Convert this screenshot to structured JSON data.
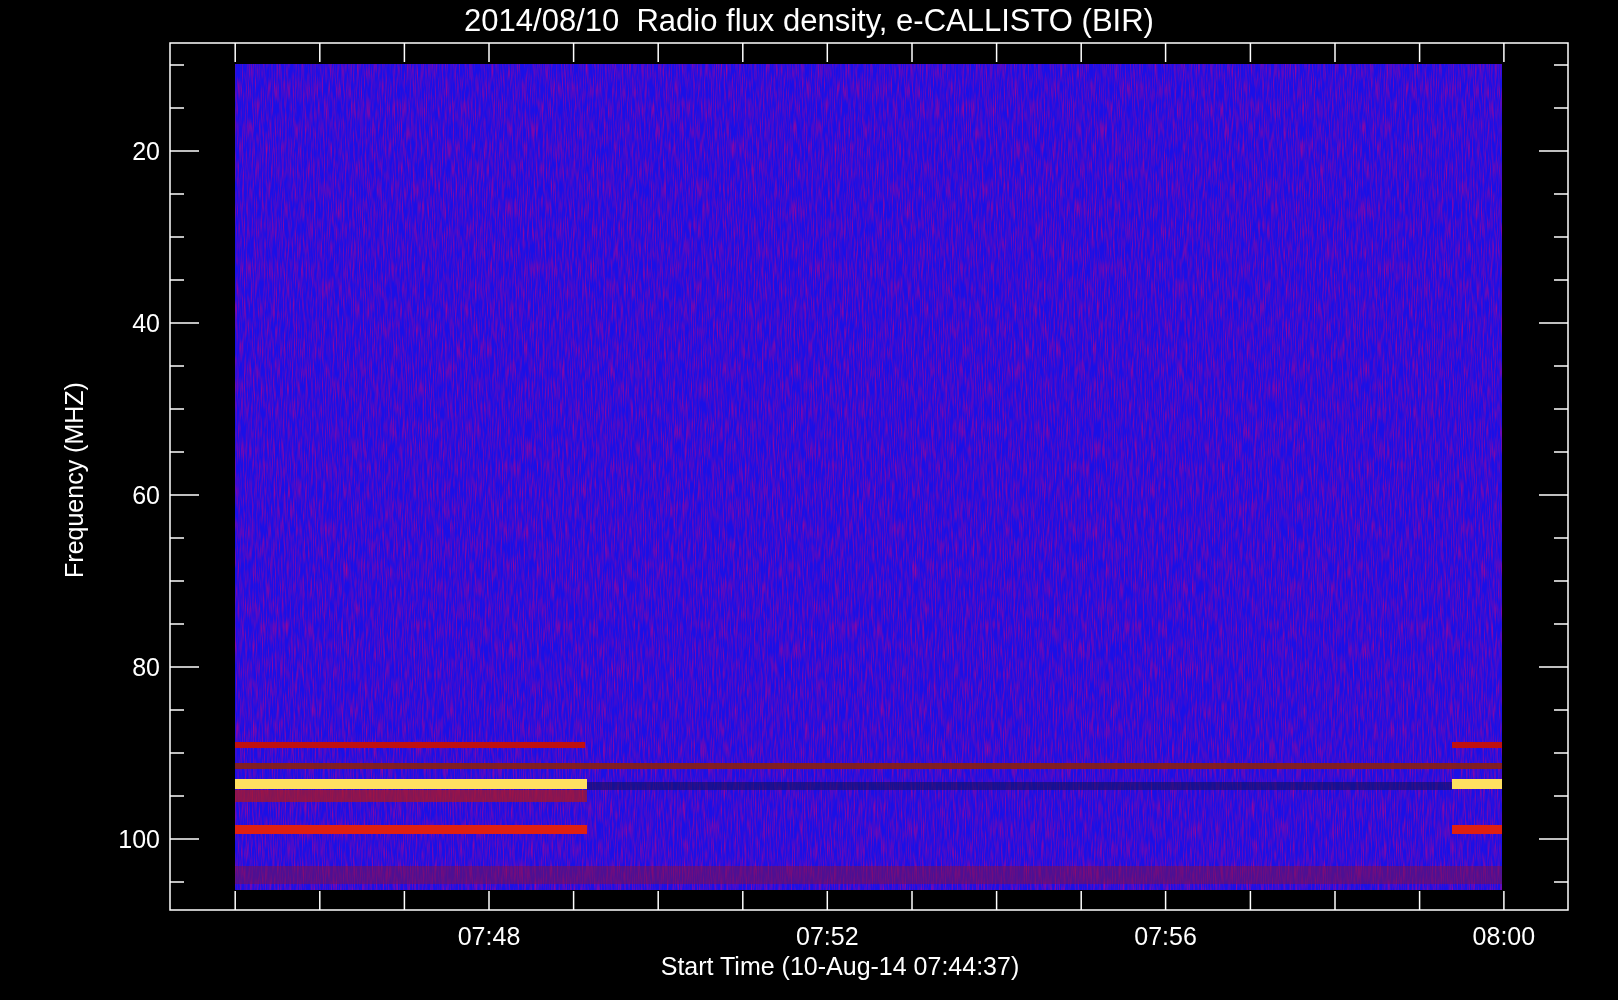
{
  "title": "2014/08/10  Radio flux density, e-CALLISTO (BIR)",
  "xlabel": "Start Time (10-Aug-14 07:44:37)",
  "ylabel": "Frequency (MHZ)",
  "x_ticks": [
    {
      "label": "07:48"
    },
    {
      "label": "07:52"
    },
    {
      "label": "07:56"
    },
    {
      "label": "08:00"
    }
  ],
  "y_ticks": [
    {
      "label": "20"
    },
    {
      "label": "40"
    },
    {
      "label": "60"
    },
    {
      "label": "80"
    },
    {
      "label": "100"
    }
  ]
}
